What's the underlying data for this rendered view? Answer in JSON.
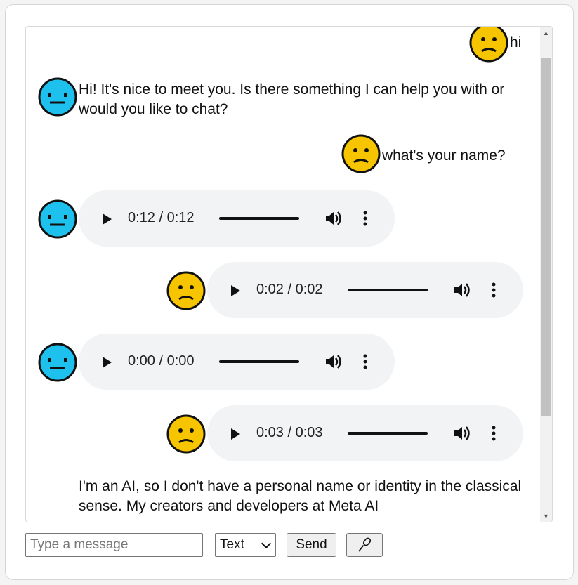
{
  "messages": [
    {
      "sender": "user",
      "type": "text",
      "text": "hi"
    },
    {
      "sender": "bot",
      "type": "text",
      "text": "Hi! It's nice to meet you. Is there something I can help you with or would you like to chat?"
    },
    {
      "sender": "user",
      "type": "text",
      "text": "what's your name?"
    },
    {
      "sender": "bot",
      "type": "audio",
      "time": "0:12 / 0:12",
      "progress": 1.0
    },
    {
      "sender": "user",
      "type": "audio",
      "time": "0:02 / 0:02",
      "progress": 1.0
    },
    {
      "sender": "bot",
      "type": "audio",
      "time": "0:00 / 0:00",
      "progress": 0
    },
    {
      "sender": "user",
      "type": "audio",
      "time": "0:03 / 0:03",
      "progress": 1.0
    },
    {
      "sender": "bot",
      "type": "text",
      "text": "I'm an AI, so I don't have a personal name or identity in the classical sense. My creators and developers at Meta AI"
    }
  ],
  "input": {
    "placeholder": "Type a message",
    "value": ""
  },
  "mode_select": {
    "selected": "Text"
  },
  "send_button": {
    "label": "Send"
  },
  "mic_button": {
    "icon": "microphone-icon"
  },
  "colors": {
    "user_avatar": "#f7c500",
    "bot_avatar": "#1ec0ee",
    "player_bg": "#f1f3f4"
  }
}
